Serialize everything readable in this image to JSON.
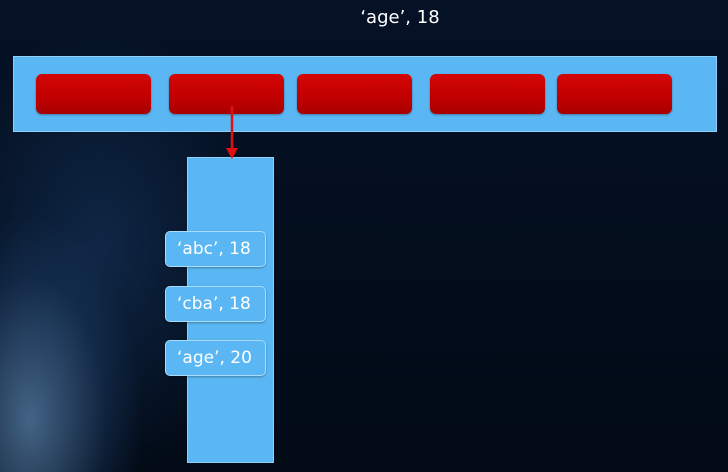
{
  "slide": {
    "title": "‘age’, 18",
    "buckets": [
      "",
      "",
      "",
      "",
      ""
    ],
    "selected_bucket_index": 1,
    "chain_entries": [
      {
        "label": "‘abc’, 18"
      },
      {
        "label": "‘cba’, 18"
      },
      {
        "label": "‘age’, 20"
      }
    ],
    "colors": {
      "background": "#041024",
      "table": "#5bb7f3",
      "bucket": "#c00000",
      "arrow": "#e01010",
      "text": "#ffffff"
    }
  }
}
